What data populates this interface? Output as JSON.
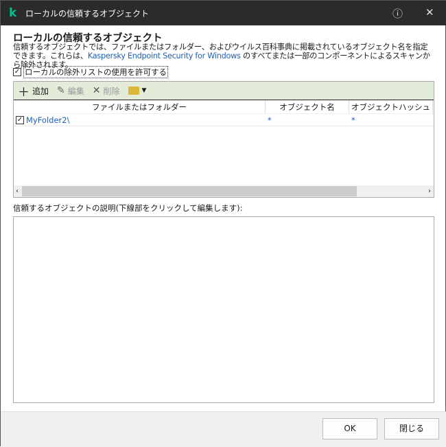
{
  "window": {
    "title": "ローカルの信頼するオブジェクト",
    "help_icon": "help-circle-icon",
    "close_icon": "close-icon"
  },
  "heading": "ローカルの信頼するオブジェクト",
  "description": {
    "part1": "信頼するオブジェクトでは、ファイルまたはフォルダー、およびウイルス百科事典に掲載されているオブジェクト名を指定できます。これらは、",
    "product": "Kaspersky Endpoint Security for Windows",
    "part2": " のすべてまたは一部のコンポーネントによるスキャンから除外されます。"
  },
  "allow_local": {
    "label": "ローカルの除外リストの使用を許可する",
    "checked": true
  },
  "toolbar": {
    "add": "追加",
    "edit": "編集",
    "delete": "削除"
  },
  "table": {
    "columns": [
      "ファイルまたはフォルダー",
      "オブジェクト名",
      "オブジェクトハッシュ"
    ],
    "rows": [
      {
        "checked": true,
        "path": "MyFolder2\\",
        "name": "*",
        "hash": "*"
      }
    ]
  },
  "desc_label": "信頼するオブジェクトの説明(下線部をクリックして編集します):",
  "buttons": {
    "ok": "OK",
    "close": "閉じる"
  },
  "colors": {
    "accent": "#00c08b",
    "toolbar": "#e3ecd8",
    "link": "#2060b0"
  }
}
